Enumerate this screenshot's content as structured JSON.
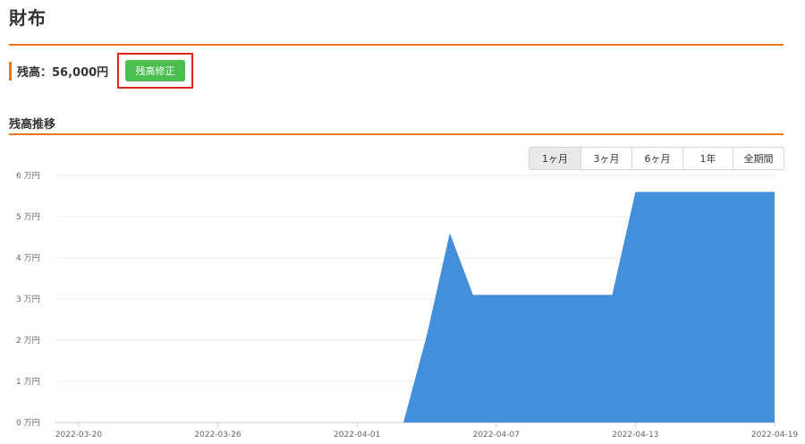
{
  "page": {
    "title": "財布"
  },
  "balance": {
    "label": "残高：56,000円",
    "fix_button": "残高修正"
  },
  "section": {
    "title": "残高推移"
  },
  "range_buttons": [
    {
      "label": "1ヶ月",
      "active": true
    },
    {
      "label": "3ヶ月",
      "active": false
    },
    {
      "label": "6ヶ月",
      "active": false
    },
    {
      "label": "1年",
      "active": false
    },
    {
      "label": "全期間",
      "active": false
    }
  ],
  "colors": {
    "accent": "#e8781a",
    "button_green": "#4cbe4f",
    "highlight_red": "#e0211b",
    "area_fill": "#448fdc"
  },
  "chart_data": {
    "type": "area",
    "title": "",
    "xlabel": "",
    "ylabel": "",
    "ylim": [
      0,
      60000
    ],
    "xlim": [
      "2022-03-19",
      "2022-04-19"
    ],
    "y_ticks": [
      0,
      10000,
      20000,
      30000,
      40000,
      50000,
      60000
    ],
    "y_tick_labels": [
      "0 万円",
      "1 万円",
      "2 万円",
      "3 万円",
      "4 万円",
      "5 万円",
      "6 万円"
    ],
    "x_ticks": [
      "2022-03-20",
      "2022-03-26",
      "2022-04-01",
      "2022-04-07",
      "2022-04-13",
      "2022-04-19"
    ],
    "x_tick_labels": [
      "2022-03-20",
      "2022-03-26",
      "2022-04-01",
      "2022-04-07",
      "2022-04-13",
      "2022-04-19"
    ],
    "grid": true,
    "series": [
      {
        "x": [
          "2022-04-03",
          "2022-04-04",
          "2022-04-05",
          "2022-04-06",
          "2022-04-07",
          "2022-04-08",
          "2022-04-09",
          "2022-04-10",
          "2022-04-11",
          "2022-04-12",
          "2022-04-13",
          "2022-04-14",
          "2022-04-15",
          "2022-04-16",
          "2022-04-17",
          "2022-04-18",
          "2022-04-19"
        ],
        "values": [
          0,
          21000,
          46000,
          31000,
          31000,
          31000,
          31000,
          31000,
          31000,
          31000,
          56000,
          56000,
          56000,
          56000,
          56000,
          56000,
          56000
        ]
      }
    ]
  }
}
